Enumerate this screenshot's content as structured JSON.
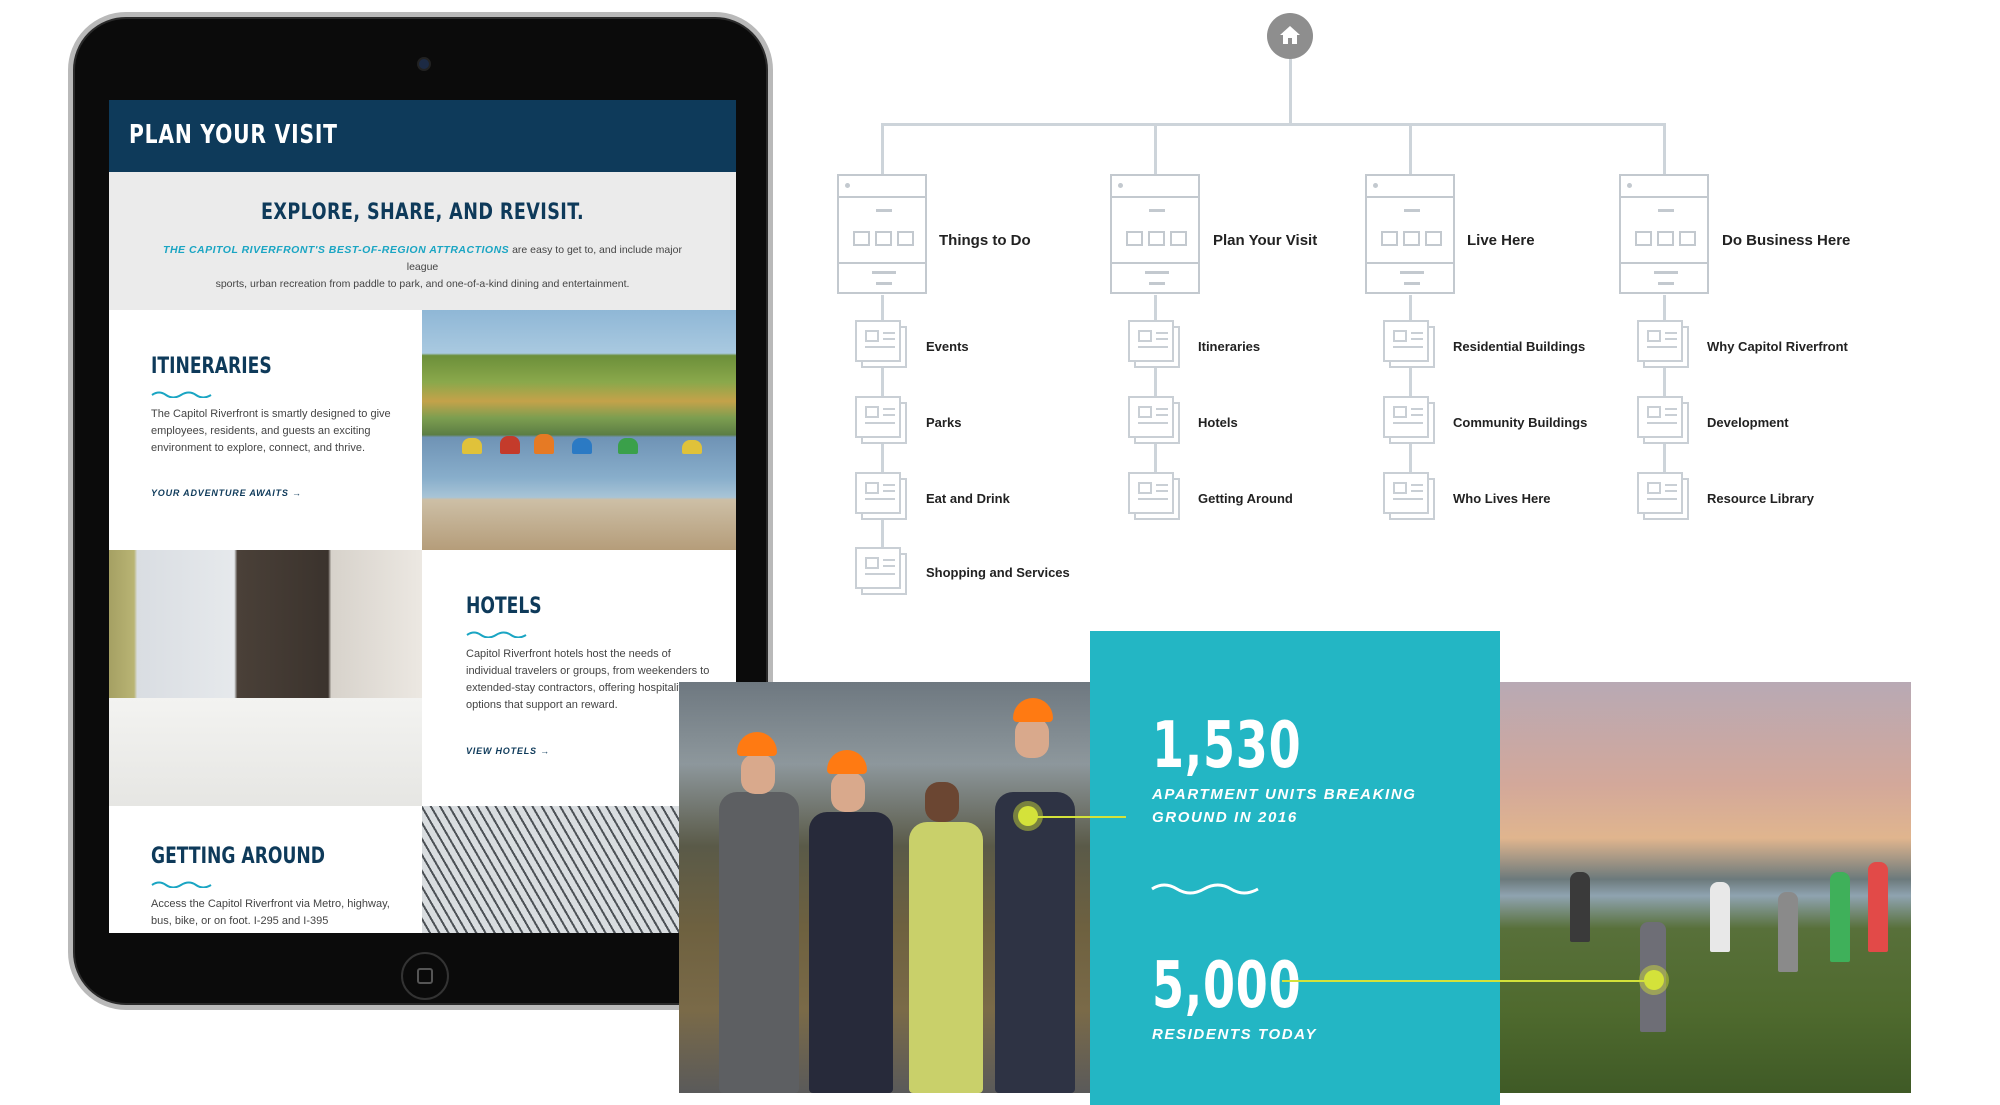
{
  "tablet": {
    "header_title": "PLAN YOUR VISIT",
    "explore": {
      "heading": "EXPLORE, SHARE, AND REVISIT.",
      "emphasis": "THE CAPITOL RIVERFRONT'S BEST-OF-REGION ATTRACTIONS",
      "body_line1_rest": " are easy to get to, and include major league",
      "body_line2": "sports, urban recreation from paddle to park, and one-of-a-kind dining and entertainment."
    },
    "itineraries": {
      "heading": "ITINERARIES",
      "text": "The Capitol Riverfront is smartly designed to give employees, residents, and guests an exciting environment to explore, connect, and thrive.",
      "link": "YOUR ADVENTURE AWAITS →"
    },
    "hotels": {
      "heading": "HOTELS",
      "text": "Capitol Riverfront hotels host the needs of individual travelers or groups, from weekenders to extended-stay contractors, offering hospitality options that support an reward.",
      "link": "VIEW HOTELS →"
    },
    "getting_around": {
      "heading": "GETTING AROUND",
      "text": "Access the Capitol Riverfront via Metro, highway, bus, bike, or on foot. I-295 and I-395"
    }
  },
  "sitemap": {
    "root_icon": "home-icon",
    "sections": [
      {
        "label": "Things to Do",
        "children": [
          "Events",
          "Parks",
          "Eat and Drink",
          "Shopping and Services"
        ]
      },
      {
        "label": "Plan Your Visit",
        "children": [
          "Itineraries",
          "Hotels",
          "Getting Around"
        ]
      },
      {
        "label": "Live Here",
        "children": [
          "Residential Buildings",
          "Community Buildings",
          "Who Lives Here"
        ]
      },
      {
        "label": "Do Business Here",
        "children": [
          "Why Capitol Riverfront",
          "Development",
          "Resource Library"
        ]
      }
    ]
  },
  "stats": {
    "stat1_number": "1,530",
    "stat1_label_line1": "APARTMENT UNITS BREAKING",
    "stat1_label_line2": "GROUND IN 2016",
    "stat2_number": "5,000",
    "stat2_label": "RESIDENTS TODAY"
  },
  "colors": {
    "navy": "#0e3a5a",
    "teal": "#23b6c4",
    "accent_blue": "#1aa5c3",
    "callout_green": "#d4e23a",
    "wireframe_gray": "#c3c9cf"
  }
}
